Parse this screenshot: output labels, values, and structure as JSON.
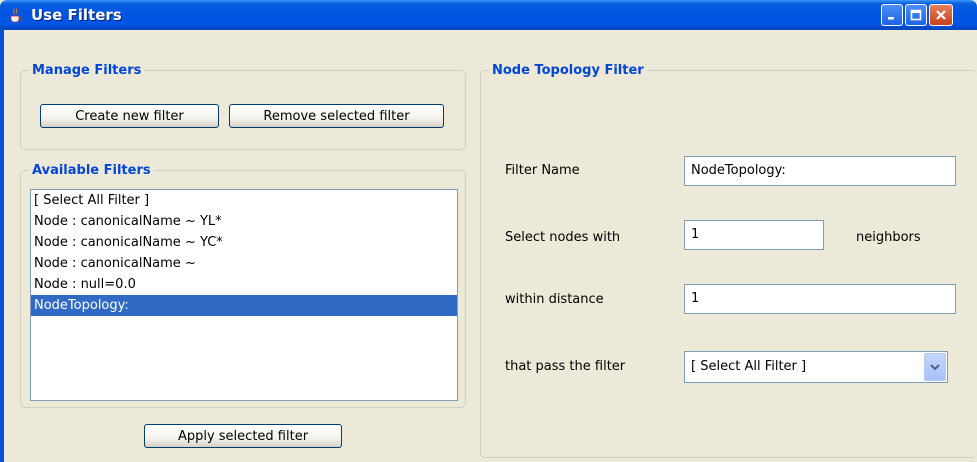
{
  "window": {
    "title": "Use Filters",
    "icon": "java-cup-icon"
  },
  "manage_filters": {
    "title": "Manage Filters",
    "create_button": "Create new filter",
    "remove_button": "Remove selected filter"
  },
  "available_filters": {
    "title": "Available Filters",
    "items": [
      {
        "label": "[ Select All Filter ]",
        "selected": false
      },
      {
        "label": "Node : canonicalName ~ YL*",
        "selected": false
      },
      {
        "label": "Node : canonicalName ~ YC*",
        "selected": false
      },
      {
        "label": "Node : canonicalName ~",
        "selected": false
      },
      {
        "label": "Node : null=0.0",
        "selected": false
      },
      {
        "label": "NodeTopology:",
        "selected": true
      }
    ],
    "apply_button": "Apply selected filter"
  },
  "topology_filter": {
    "title": "Node Topology Filter",
    "filter_name_label": "Filter Name",
    "filter_name_value": "NodeTopology:",
    "select_nodes_label": "Select nodes with",
    "select_nodes_value": "1",
    "neighbors_label": "neighbors",
    "within_distance_label": "within distance",
    "within_distance_value": "1",
    "pass_filter_label": "that pass the filter",
    "pass_filter_value": "[ Select All Filter ]"
  },
  "colors": {
    "titlebar": "#0054e3",
    "group_title": "#0046d5",
    "selection": "#316ac5",
    "background": "#ece9d8"
  }
}
